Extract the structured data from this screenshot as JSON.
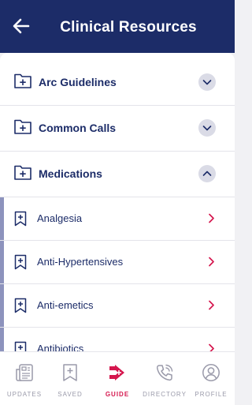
{
  "header": {
    "title": "Clinical Resources",
    "back_icon": "arrow-left-icon"
  },
  "folders": [
    {
      "label": "Arc Guidelines",
      "expanded": false
    },
    {
      "label": "Common Calls",
      "expanded": false
    },
    {
      "label": "Medications",
      "expanded": true
    }
  ],
  "medications": [
    {
      "label": "Analgesia"
    },
    {
      "label": "Anti-Hypertensives"
    },
    {
      "label": "Anti-emetics"
    },
    {
      "label": "Antibiotics"
    }
  ],
  "tabs": [
    {
      "label": "UPDATES",
      "icon": "news-icon",
      "active": false
    },
    {
      "label": "SAVED",
      "icon": "bookmark-icon",
      "active": false
    },
    {
      "label": "GUIDE",
      "icon": "guide-icon",
      "active": true
    },
    {
      "label": "DIRECTORY",
      "icon": "phone-icon",
      "active": false
    },
    {
      "label": "PROFILE",
      "icon": "profile-icon",
      "active": false
    }
  ],
  "colors": {
    "header": "#1c2c68",
    "accent": "#d5174e",
    "chevron_bg": "#dadbe6",
    "indicator": "#8d93bd"
  }
}
